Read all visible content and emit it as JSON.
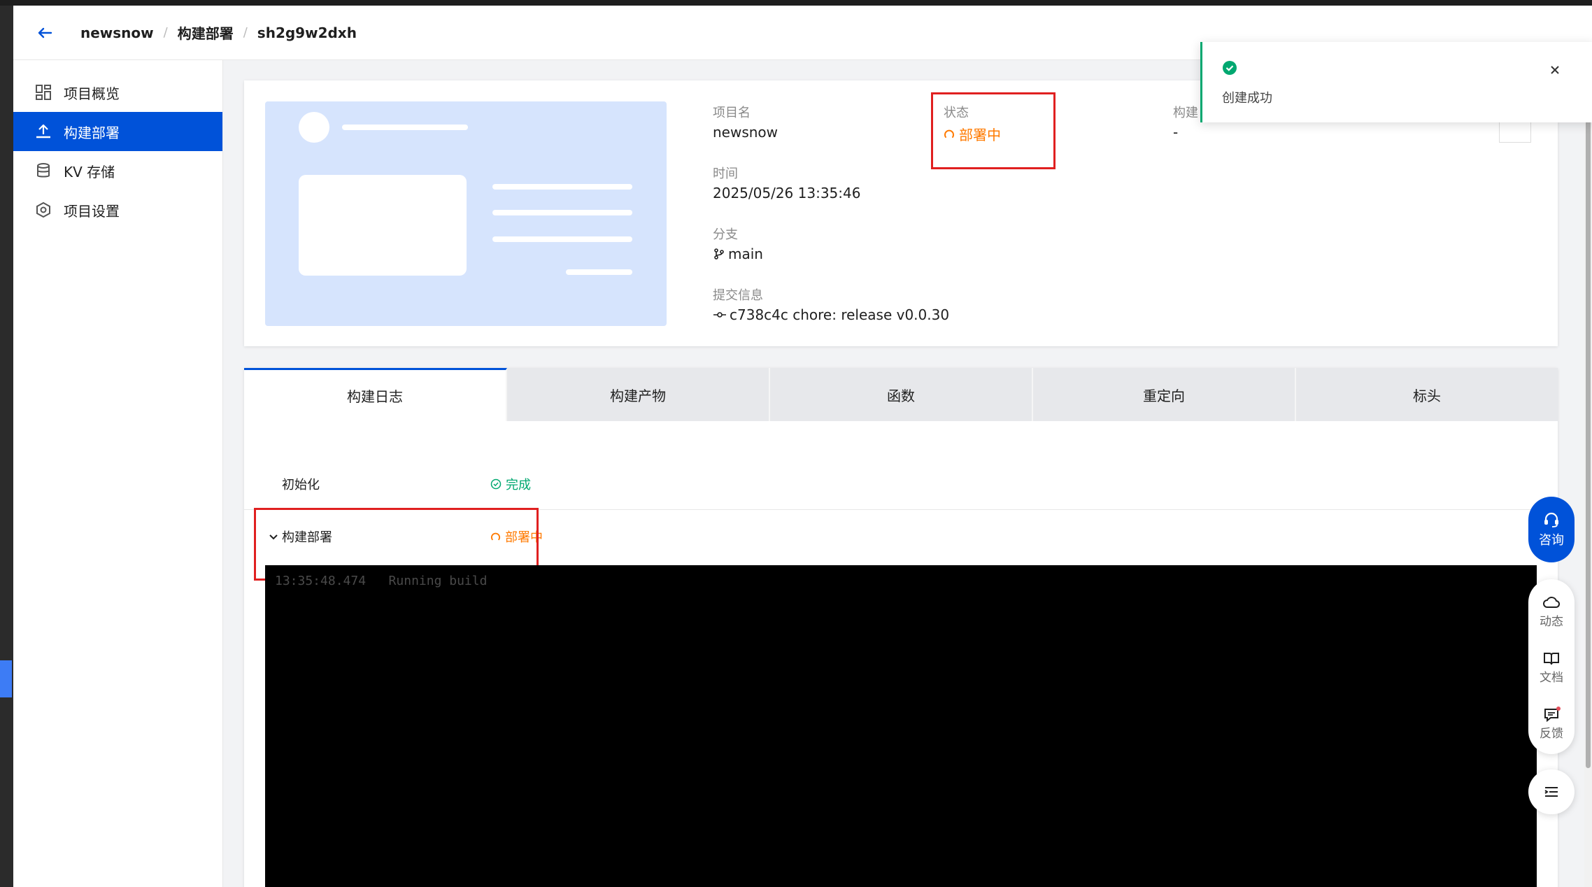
{
  "breadcrumb": {
    "project": "newsnow",
    "section": "构建部署",
    "deployment": "sh2g9w2dxh",
    "separator": "/"
  },
  "sidebar": {
    "items": [
      {
        "label": "项目概览",
        "icon": "dashboard-icon"
      },
      {
        "label": "构建部署",
        "icon": "upload-icon",
        "active": true
      },
      {
        "label": "KV 存储",
        "icon": "database-icon"
      },
      {
        "label": "项目设置",
        "icon": "settings-icon"
      }
    ]
  },
  "project_info": {
    "name_label": "项目名",
    "name_value": "newsnow",
    "status_label": "状态",
    "status_value": "部署中",
    "build_label": "构建",
    "build_value": "-",
    "time_label": "时间",
    "time_value": "2025/05/26 13:35:46",
    "branch_label": "分支",
    "branch_value": "main",
    "commit_label": "提交信息",
    "commit_value": "c738c4c chore: release v0.0.30"
  },
  "tabs": [
    "构建日志",
    "构建产物",
    "函数",
    "重定向",
    "标头"
  ],
  "steps": [
    {
      "name": "初始化",
      "status": "完成"
    },
    {
      "name": "构建部署",
      "status": "部署中"
    }
  ],
  "console": {
    "line": "13:35:48.474   Running build"
  },
  "toast": {
    "message": "创建成功"
  },
  "float": {
    "consult": "咨询",
    "dynamic": "动态",
    "docs": "文档",
    "feedback": "反馈"
  },
  "colors": {
    "primary": "#0052d9",
    "warning": "#ff7a00",
    "success": "#00a870",
    "highlight": "#e02020"
  }
}
